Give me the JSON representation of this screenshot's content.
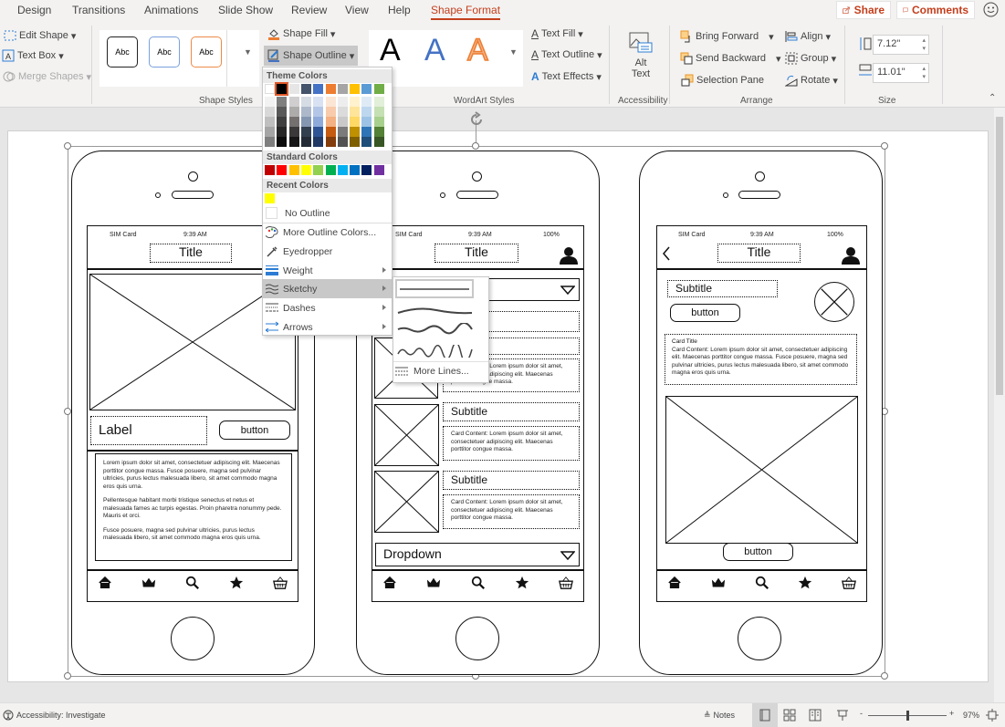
{
  "tabs": [
    {
      "label": "Design"
    },
    {
      "label": "Transitions"
    },
    {
      "label": "Animations"
    },
    {
      "label": "Slide Show"
    },
    {
      "label": "Review"
    },
    {
      "label": "View"
    },
    {
      "label": "Help"
    },
    {
      "label": "Shape Format",
      "active": true
    }
  ],
  "topbar": {
    "share": "Share",
    "comments": "Comments",
    "smiley_icon": "smiley-feedback-icon"
  },
  "ribbon": {
    "insert_shapes": {
      "edit_shape": "Edit Shape",
      "text_box": "Text Box",
      "merge_shapes": "Merge Shapes"
    },
    "shape_styles": {
      "label": "Shape Styles",
      "presets": [
        "Abc",
        "Abc",
        "Abc"
      ],
      "shape_fill": "Shape Fill",
      "shape_outline": "Shape Outline"
    },
    "wordart": {
      "label": "WordArt Styles",
      "presets": [
        "A",
        "A",
        "A"
      ],
      "text_fill": "Text Fill",
      "text_outline": "Text Outline",
      "text_effects": "Text Effects"
    },
    "accessibility": {
      "label": "Accessibility",
      "alt_text_1": "Alt",
      "alt_text_2": "Text"
    },
    "arrange": {
      "label": "Arrange",
      "bring_forward": "Bring Forward",
      "send_backward": "Send Backward",
      "selection_pane": "Selection Pane",
      "align": "Align",
      "group": "Group",
      "rotate": "Rotate"
    },
    "size": {
      "label": "Size",
      "height": "7.12\"",
      "width": "11.01\""
    }
  },
  "outline_menu": {
    "theme_colors_label": "Theme Colors",
    "theme_colors": [
      "#ffffff",
      "#000000",
      "#e7e6e6",
      "#44546a",
      "#4472c4",
      "#ed7d31",
      "#a5a5a5",
      "#ffc000",
      "#5b9bd5",
      "#70ad47"
    ],
    "theme_shades": [
      [
        "#f2f2f2",
        "#7f7f7f",
        "#d0cece",
        "#d6dce4",
        "#d9e2f3",
        "#fbe5d5",
        "#ededed",
        "#fff2cc",
        "#deebf6",
        "#e2efd9"
      ],
      [
        "#d8d8d8",
        "#595959",
        "#aeabab",
        "#adb9ca",
        "#b4c6e7",
        "#f7cbac",
        "#dbdbdb",
        "#fee599",
        "#bdd7ee",
        "#c5e0b3"
      ],
      [
        "#bfbfbf",
        "#3f3f3f",
        "#757070",
        "#8496b0",
        "#8eaadb",
        "#f4b183",
        "#c9c9c9",
        "#ffd965",
        "#9cc3e5",
        "#a8d08d"
      ],
      [
        "#a5a5a5",
        "#262626",
        "#3a3838",
        "#323f4f",
        "#2f5496",
        "#c55a11",
        "#7b7b7b",
        "#bf9000",
        "#2e75b5",
        "#538135"
      ],
      [
        "#7f7f7f",
        "#0c0c0c",
        "#171616",
        "#222a35",
        "#1f3864",
        "#833c0b",
        "#525252",
        "#7f6000",
        "#1e4e79",
        "#375623"
      ]
    ],
    "selected_color": "#000000",
    "standard_colors_label": "Standard Colors",
    "standard_colors": [
      "#c00000",
      "#ff0000",
      "#ffc000",
      "#ffff00",
      "#92d050",
      "#00b050",
      "#00b0f0",
      "#0070c0",
      "#002060",
      "#7030a0"
    ],
    "recent_colors_label": "Recent Colors",
    "recent_colors": [
      "#ffff00"
    ],
    "no_outline": "No Outline",
    "more_colors": "More Outline Colors...",
    "eyedropper": "Eyedropper",
    "weight": "Weight",
    "sketchy": "Sketchy",
    "dashes": "Dashes",
    "arrows": "Arrows"
  },
  "sketchy_submenu": {
    "options": [
      "none",
      "curved",
      "freehand",
      "scribble"
    ],
    "selected": "none",
    "more_lines": "More Lines..."
  },
  "phones": {
    "status": {
      "carrier": "SIM Card",
      "time": "9:39 AM",
      "battery": "100%"
    },
    "title": "Title",
    "phone1": {
      "label": "Label",
      "button": "button",
      "paragraphs": [
        "Lorem ipsum dolor sit amet, consectetuer adipiscing elit. Maecenas porttitor congue massa. Fusce posuere, magna sed pulvinar ultricies, purus lectus malesuada libero, sit amet commodo magna eros quis urna.",
        "Pellentesque habitant morbi tristique senectus et netus et malesuada fames ac turpis egestas. Proin pharetra nonummy pede. Mauris et orci.",
        "Fusce posuere, magna sed pulvinar ultricies, purus lectus malesuada libero, sit amet commodo magna eros quis urna."
      ]
    },
    "phone2": {
      "subtitle": "Subtitle",
      "card": "Card Content: Lorem ipsum dolor sit amet, consectetuer adipiscing elit. Maecenas porttitor congue massa.",
      "dropdown": "Dropdown"
    },
    "phone3": {
      "subtitle": "Subtitle",
      "button": "button",
      "card_title": "Card Title",
      "card_content": "Card Content: Lorem ipsum dolor sit amet, consectetuer adipiscing elit. Maecenas porttitor congue massa. Fusce posuere, magna sed pulvinar ultricies, purus lectus malesuada libero, sit amet commodo magna eros quis urna.",
      "bottom_button": "button"
    },
    "nav_icons": [
      "home-icon",
      "crown-icon",
      "search-icon",
      "star-icon",
      "basket-icon"
    ]
  },
  "status_bar": {
    "accessibility": "Accessibility: Investigate",
    "notes": "Notes",
    "zoom": "97%",
    "zoom_level_percent": 97
  }
}
